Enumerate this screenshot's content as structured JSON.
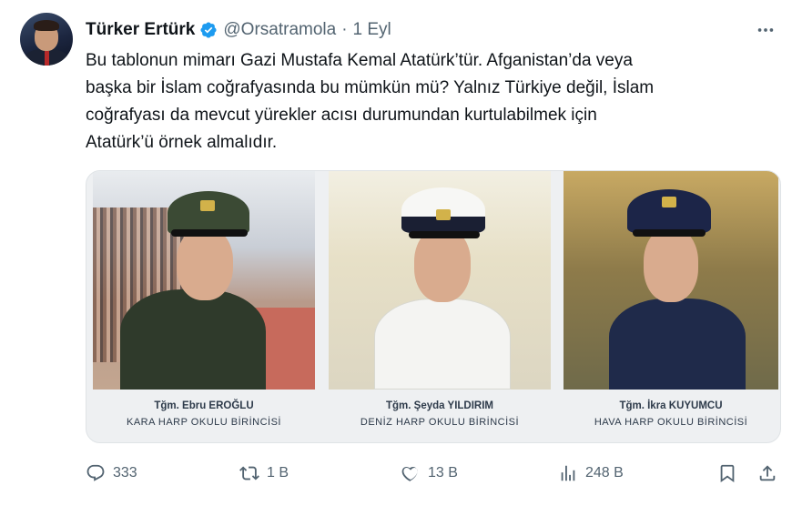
{
  "author": {
    "name": "Türker Ertürk",
    "handle": "@Orsatramola",
    "separator": "·",
    "time": "1 Eyl",
    "verified": true,
    "verified_color": "#1d9bf0"
  },
  "tweet": {
    "lines": [
      "Bu tablonun mimarı Gazi Mustafa Kemal Atatürk’tür. Afganistan’da veya",
      "başka bir İslam coğrafyasında bu mümkün mü? Yalnız Türkiye değil, İslam",
      "coğrafyası da mevcut yürekler acısı durumundan kurtulabilmek için",
      "Atatürk’ü örnek almalıdır."
    ]
  },
  "media": {
    "panels": [
      {
        "name": "Tğm. Ebru EROĞLU",
        "school": "KARA HARP OKULU BİRİNCİSİ"
      },
      {
        "name": "Tğm. Şeyda YILDIRIM",
        "school": "DENİZ HARP OKULU BİRİNCİSİ"
      },
      {
        "name": "Tğm. İkra KUYUMCU",
        "school": "HAVA HARP OKULU BİRİNCİSİ"
      }
    ]
  },
  "actions": {
    "reply": {
      "icon": "reply-icon",
      "count": "333"
    },
    "retweet": {
      "icon": "retweet-icon",
      "count": "1 B"
    },
    "like": {
      "icon": "heart-icon",
      "count": "13 B"
    },
    "views": {
      "icon": "views-icon",
      "count": "248 B"
    },
    "bookmark": {
      "icon": "bookmark-icon"
    },
    "share": {
      "icon": "share-icon"
    }
  },
  "more_icon": "more-icon",
  "colors": {
    "text": "#0f1419",
    "muted": "#536471",
    "accent": "#1d9bf0"
  }
}
